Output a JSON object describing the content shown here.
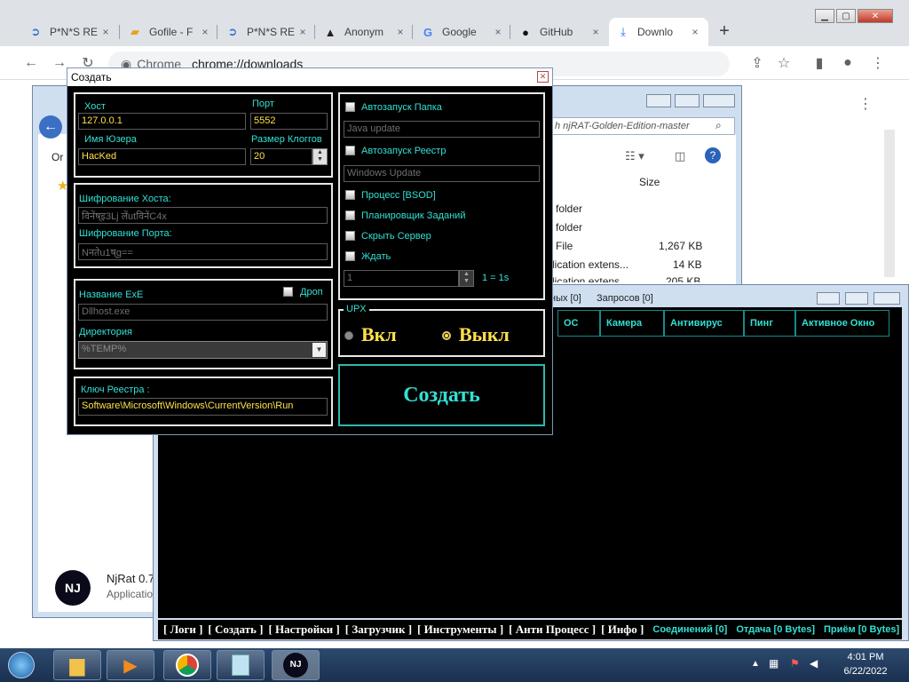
{
  "browser": {
    "tabs": [
      {
        "label": "P*N*S RE",
        "icon": "rat-icon"
      },
      {
        "label": "Gofile - F",
        "icon": "folder-icon"
      },
      {
        "label": "P*N*S RE",
        "icon": "rat-icon"
      },
      {
        "label": "Anonym",
        "icon": "anon-icon"
      },
      {
        "label": "Google",
        "icon": "google-icon"
      },
      {
        "label": "GitHub",
        "icon": "github-icon"
      },
      {
        "label": "Downlo",
        "icon": "download-icon"
      }
    ],
    "close_glyph": "×",
    "new_tab_glyph": "+",
    "address_prefix": "Chrome",
    "address": "chrome://downloads"
  },
  "explorer": {
    "search_text": "h njRAT-Golden-Edition-master",
    "nav_left": "Or",
    "size_header": "Size",
    "rows": [
      {
        "type": "folder",
        "size": ""
      },
      {
        "type": "folder",
        "size": ""
      },
      {
        "type": "File",
        "size": "1,267 KB"
      },
      {
        "type": "lication extens...",
        "size": "14 KB"
      },
      {
        "type": "lication extens",
        "size": "205 KB"
      }
    ]
  },
  "download_item": {
    "name": "NjRat 0.7",
    "sub": "Application"
  },
  "njmain": {
    "tab_hint": "ных [0]",
    "requests": "Запросов [0]",
    "columns": [
      "ОС",
      "Камера",
      "Антивирус",
      "Пинг",
      "Активное Окно"
    ],
    "menu": [
      "[ Логи ]",
      "[ Создать ]",
      "[ Настройки ]",
      "[ Загрузчик ]",
      "[ Инструменты ]",
      "[ Анти Процесс ]",
      "[ Инфо ]"
    ],
    "status": [
      "Соединений [0]",
      "Отдача [0 Bytes]",
      "Приём [0 Bytes]"
    ]
  },
  "dialog": {
    "title": "Создать",
    "host_label": "Хост",
    "host_value": "127.0.0.1",
    "port_label": "Порт",
    "port_value": "5552",
    "user_label": "Имя Юзера",
    "user_value": "HacKed",
    "log_label": "Размер Клоггов",
    "log_value": "20",
    "enc_host_label": "Шифрование Хоста:",
    "enc_host_value": "विनेंष्इ3Lj लेंutविनेंC4x",
    "enc_port_label": "Шифрование Порта:",
    "enc_port_value": "Nनतेu1ष्g==",
    "exe_label": "Название ExE",
    "drop_label": "Дроп",
    "exe_value": "Dllhost.exe",
    "dir_label": "Директория",
    "dir_value": "%TEMP%",
    "reg_label": "Ключ Реестра :",
    "reg_value": "Software\\Microsoft\\Windows\\CurrentVersion\\Run",
    "autorun_folder": "Автозапуск Папка",
    "autorun_folder_value": "Java update",
    "autorun_reg": "Автозапуск Реестр",
    "autorun_reg_value": "Windows Update",
    "bsod": "Процесс [BSOD]",
    "scheduler": "Планировщик Заданий",
    "hide": "Скрыть Сервер",
    "wait": "Ждать",
    "wait_value": "1",
    "wait_hint": "1 = 1s",
    "upx_label": "UPX",
    "upx_on": "Вкл",
    "upx_off": "Выкл",
    "upx_selected": "off",
    "create_button": "Создать"
  },
  "taskbar": {
    "time": "4:01 PM",
    "date": "6/22/2022"
  },
  "colors": {
    "cyan": "#32e0d4",
    "yellow": "#ffe14b",
    "panel_border": "#e8e8e8"
  }
}
